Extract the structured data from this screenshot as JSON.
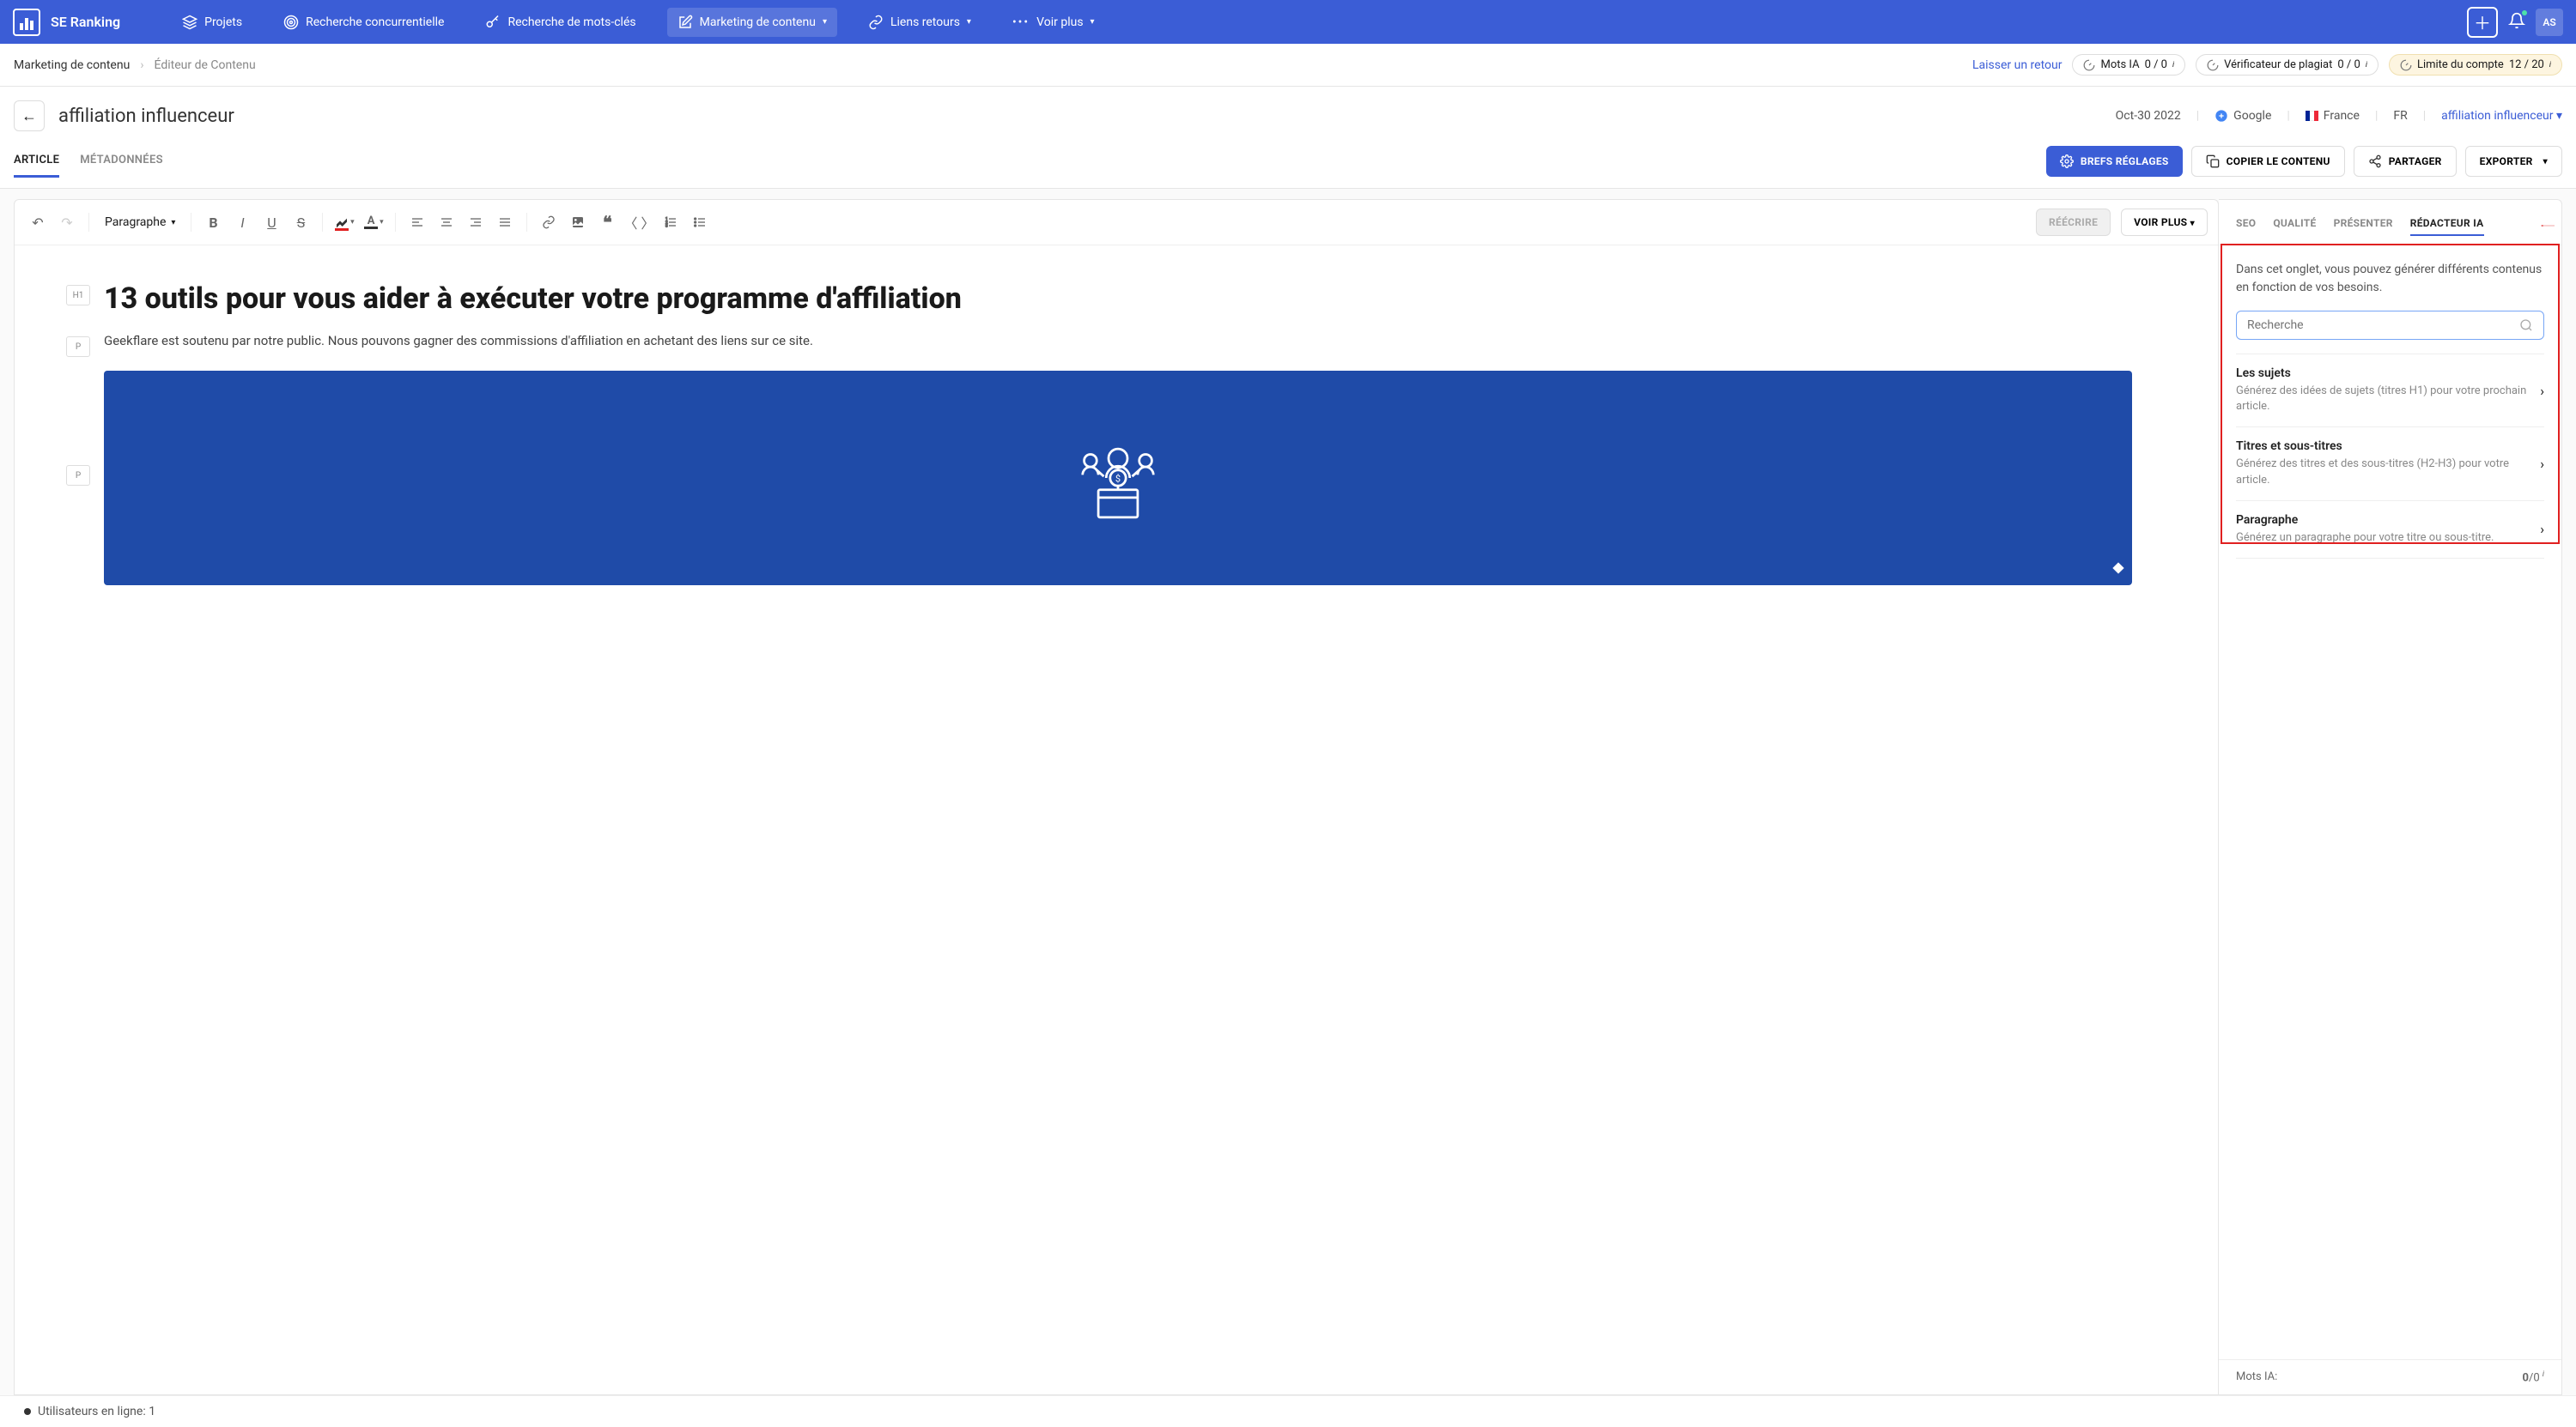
{
  "brand": "SE Ranking",
  "nav": {
    "projets": "Projets",
    "concurrentielle": "Recherche concurrentielle",
    "motscles": "Recherche de mots-clés",
    "contenu": "Marketing de contenu",
    "liens": "Liens retours",
    "voirplus": "Voir plus"
  },
  "avatar": "AS",
  "breadcrumb": {
    "b1": "Marketing de contenu",
    "b2": "Éditeur de Contenu",
    "feedback": "Laisser un retour",
    "motsIA_label": "Mots IA",
    "motsIA_value": "0 / 0",
    "plagiat_label": "Vérificateur de plagiat",
    "plagiat_value": "0 / 0",
    "limite_label": "Limite du compte",
    "limite_value": "12 / 20"
  },
  "title": {
    "text": "affiliation influenceur",
    "date": "Oct-30 2022",
    "engine": "Google",
    "country": "France",
    "lang": "FR",
    "keyword": "affiliation influenceur"
  },
  "tabs": {
    "article": "ARTICLE",
    "meta": "MÉTADONNÉES"
  },
  "actions": {
    "brefs": "BREFS RÉGLAGES",
    "copier": "COPIER LE CONTENU",
    "partager": "PARTAGER",
    "exporter": "EXPORTER"
  },
  "toolbar": {
    "undo": "↶",
    "paragraph": "Paragraphe",
    "reecrire": "RÉÉCRIRE",
    "voirplus": "VOIR PLUS"
  },
  "content": {
    "h1_tag": "H1",
    "h1": "13 outils pour vous aider à exécuter votre programme d'affiliation",
    "p_tag": "P",
    "p1": "Geekflare est soutenu par notre public. Nous pouvons gagner des commissions d'affiliation en achetant des liens sur ce site."
  },
  "sidebar": {
    "tabs": {
      "seo": "SEO",
      "qualite": "QUALITÉ",
      "presenter": "PRÉSENTER",
      "redacteur": "RÉDACTEUR IA"
    },
    "intro": "Dans cet onglet, vous pouvez générer différents contenus en fonction de vos besoins.",
    "search_placeholder": "Recherche",
    "options": {
      "sujets_title": "Les sujets",
      "sujets_desc": "Générez des idées de sujets (titres H1) pour votre prochain article.",
      "titres_title": "Titres et sous-titres",
      "titres_desc": "Générez des titres et des sous-titres (H2-H3) pour votre article.",
      "para_title": "Paragraphe",
      "para_desc": "Générez un paragraphe pour votre titre ou sous-titre."
    },
    "footer_label": "Mots IA:",
    "footer_value_bold": "0",
    "footer_value_rest": "/0"
  },
  "status": {
    "users": "Utilisateurs en ligne: 1"
  }
}
